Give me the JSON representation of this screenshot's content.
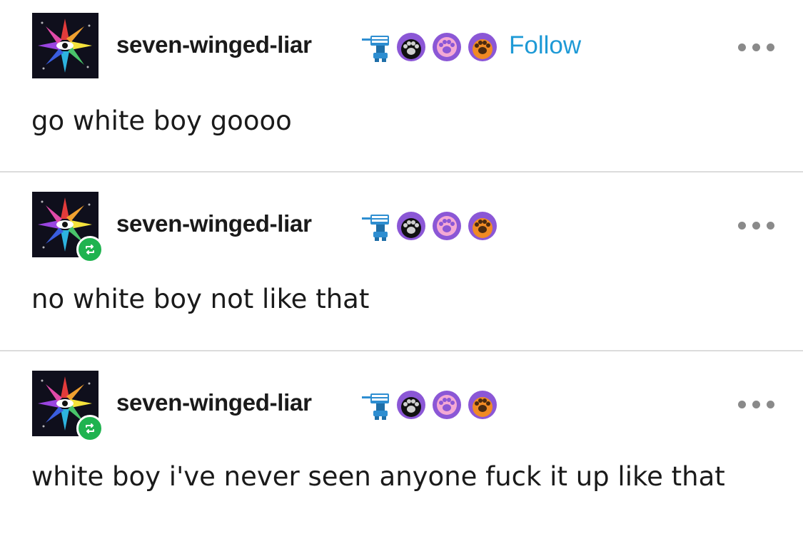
{
  "posts": [
    {
      "username": "seven-winged-liar",
      "follow_label": "Follow",
      "text": "go white boy goooo",
      "reblogged": false,
      "badges": [
        "blaster-badge-icon",
        "dark-paw-badge-icon",
        "pink-paw-badge-icon",
        "orange-paw-badge-icon"
      ]
    },
    {
      "username": "seven-winged-liar",
      "text": "no white boy not like that",
      "reblogged": true,
      "badges": [
        "blaster-badge-icon",
        "dark-paw-badge-icon",
        "pink-paw-badge-icon",
        "orange-paw-badge-icon"
      ]
    },
    {
      "username": "seven-winged-liar",
      "text": "white boy i've never seen anyone fuck it up like that",
      "reblogged": true,
      "badges": [
        "blaster-badge-icon",
        "dark-paw-badge-icon",
        "pink-paw-badge-icon",
        "orange-paw-badge-icon"
      ]
    }
  ],
  "colors": {
    "follow": "#1e9ad6",
    "reblog_badge": "#1fb34f",
    "divider": "#dcdcdc",
    "text": "#1a1a1a",
    "more_dots": "#8a8a8a",
    "badge_purple": "#8b57d6"
  },
  "icons": {
    "more": "more-options-icon",
    "reblog": "reblog-icon",
    "avatar": "avatar-starburst-icon"
  }
}
